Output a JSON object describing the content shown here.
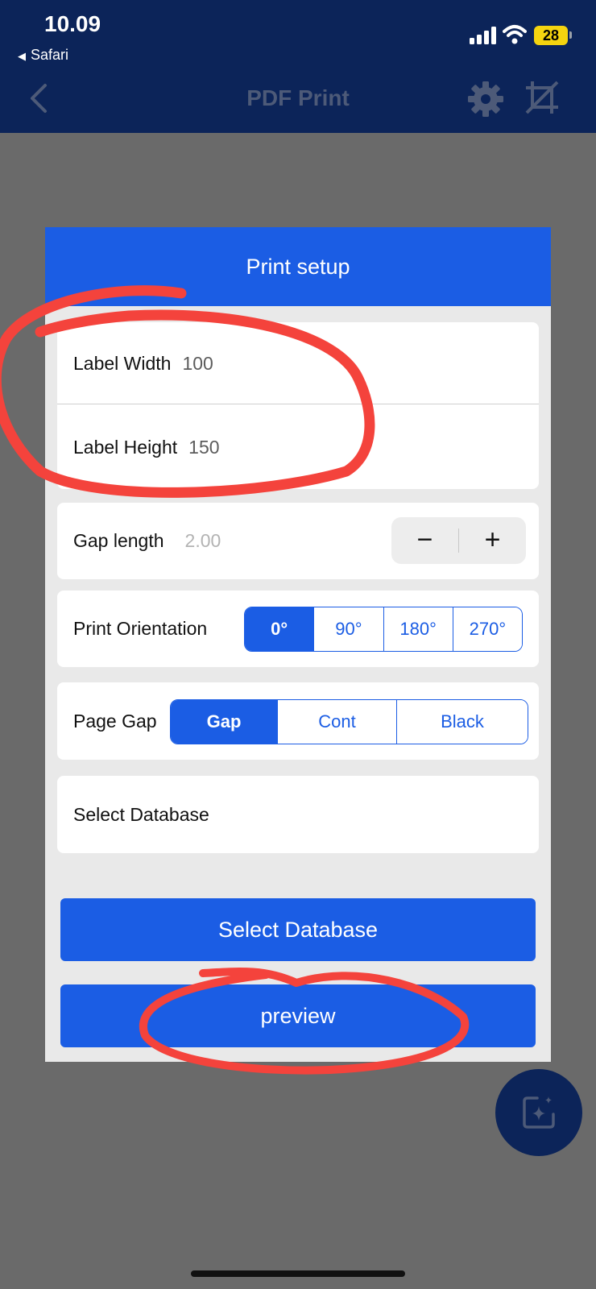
{
  "status_bar": {
    "time": "10.09",
    "back_app": "Safari",
    "battery": "28"
  },
  "nav": {
    "title": "PDF Print",
    "icons": [
      "chevron-left-icon",
      "gear-icon",
      "crop-icon"
    ]
  },
  "dialog": {
    "title": "Print setup",
    "label_width": {
      "label": "Label Width",
      "value": "100"
    },
    "label_height": {
      "label": "Label Height",
      "value": "150"
    },
    "gap_length": {
      "label": "Gap length",
      "placeholder": "2.00",
      "minus": "−",
      "plus": "+"
    },
    "orientation": {
      "label": "Print Orientation",
      "options": [
        "0°",
        "90°",
        "180°",
        "270°"
      ],
      "selected": "0°"
    },
    "page_gap": {
      "label": "Page Gap",
      "options": [
        "Gap",
        "Cont",
        "Black"
      ],
      "selected": "Gap"
    },
    "database_row": {
      "label": "Select Database"
    },
    "select_database_button": "Select Database",
    "preview_button": "preview"
  },
  "colors": {
    "header_bg": "#0c2459",
    "accent": "#1b5de4",
    "overlay": "#6a6a6a",
    "annotation": "#ff3b30"
  }
}
